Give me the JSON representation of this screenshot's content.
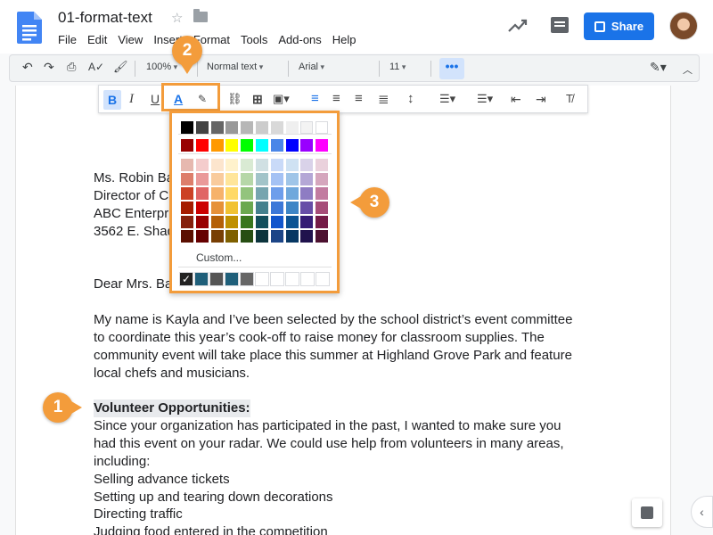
{
  "app": {
    "title": "01-format-text",
    "share_label": "Share"
  },
  "menu": [
    "File",
    "Edit",
    "View",
    "Insert",
    "Format",
    "Tools",
    "Add-ons",
    "Help"
  ],
  "toolbar": {
    "zoom": "100%",
    "style": "Normal text",
    "font": "Arial",
    "size": "11",
    "more": "•••"
  },
  "palette": {
    "custom_label": "Custom...",
    "row_gray": [
      "#000000",
      "#434343",
      "#666666",
      "#999999",
      "#b7b7b7",
      "#cccccc",
      "#d9d9d9",
      "#efefef",
      "#f3f3f3",
      "#ffffff"
    ],
    "row_bright": [
      "#980000",
      "#ff0000",
      "#ff9900",
      "#ffff00",
      "#00ff00",
      "#00ffff",
      "#4a86e8",
      "#0000ff",
      "#9900ff",
      "#ff00ff"
    ],
    "shades": [
      [
        "#e6b8af",
        "#f4cccc",
        "#fce5cd",
        "#fff2cc",
        "#d9ead3",
        "#d0e0e3",
        "#c9daf8",
        "#cfe2f3",
        "#d9d2e9",
        "#ead1dc"
      ],
      [
        "#dd7e6b",
        "#ea9999",
        "#f9cb9c",
        "#ffe599",
        "#b6d7a8",
        "#a2c4c9",
        "#a4c2f4",
        "#9fc5e8",
        "#b4a7d6",
        "#d5a6bd"
      ],
      [
        "#cc4125",
        "#e06666",
        "#f6b26b",
        "#ffd966",
        "#93c47d",
        "#76a5af",
        "#6d9eeb",
        "#6fa8dc",
        "#8e7cc3",
        "#c27ba0"
      ],
      [
        "#a61c00",
        "#cc0000",
        "#e69138",
        "#f1c232",
        "#6aa84f",
        "#45818e",
        "#3c78d8",
        "#3d85c6",
        "#674ea7",
        "#a64d79"
      ],
      [
        "#85200c",
        "#990000",
        "#b45f06",
        "#bf9000",
        "#38761d",
        "#134f5c",
        "#1155cc",
        "#0b5394",
        "#351c75",
        "#741b47"
      ],
      [
        "#5b0f00",
        "#660000",
        "#783f04",
        "#7f6000",
        "#274e13",
        "#0c343d",
        "#1c4587",
        "#073763",
        "#20124d",
        "#4c1130"
      ]
    ],
    "recent": [
      "#222222",
      "#1f5f7a",
      "#555555",
      "#1f5f7a",
      "#666666"
    ]
  },
  "document": {
    "address": [
      "Ms. Robin Ba",
      "Director of C",
      "ABC Enterpr",
      "3562 E. Shad"
    ],
    "salutation": "Dear Mrs. Ba",
    "para1": [
      "My name is Kayla and I’ve been selected by the school district’s event committee",
      "to coordinate this year’s cook-off to raise money for classroom supplies. The",
      "community event will take place this summer at Highland Grove Park and feature",
      "local chefs and musicians."
    ],
    "heading": "Volunteer Opportunities:",
    "para2": [
      "Since your organization has participated in the past, I wanted to make sure you",
      "had this event on your radar. We could use help from volunteers in many areas,",
      "including:"
    ],
    "list": [
      "Selling advance tickets",
      "Setting up and tearing down decorations",
      "Directing traffic",
      "Judging food entered in the competition"
    ]
  },
  "callouts": [
    "1",
    "2",
    "3"
  ],
  "colors": {
    "accent": "#f39c3b",
    "share": "#1a73e8"
  }
}
